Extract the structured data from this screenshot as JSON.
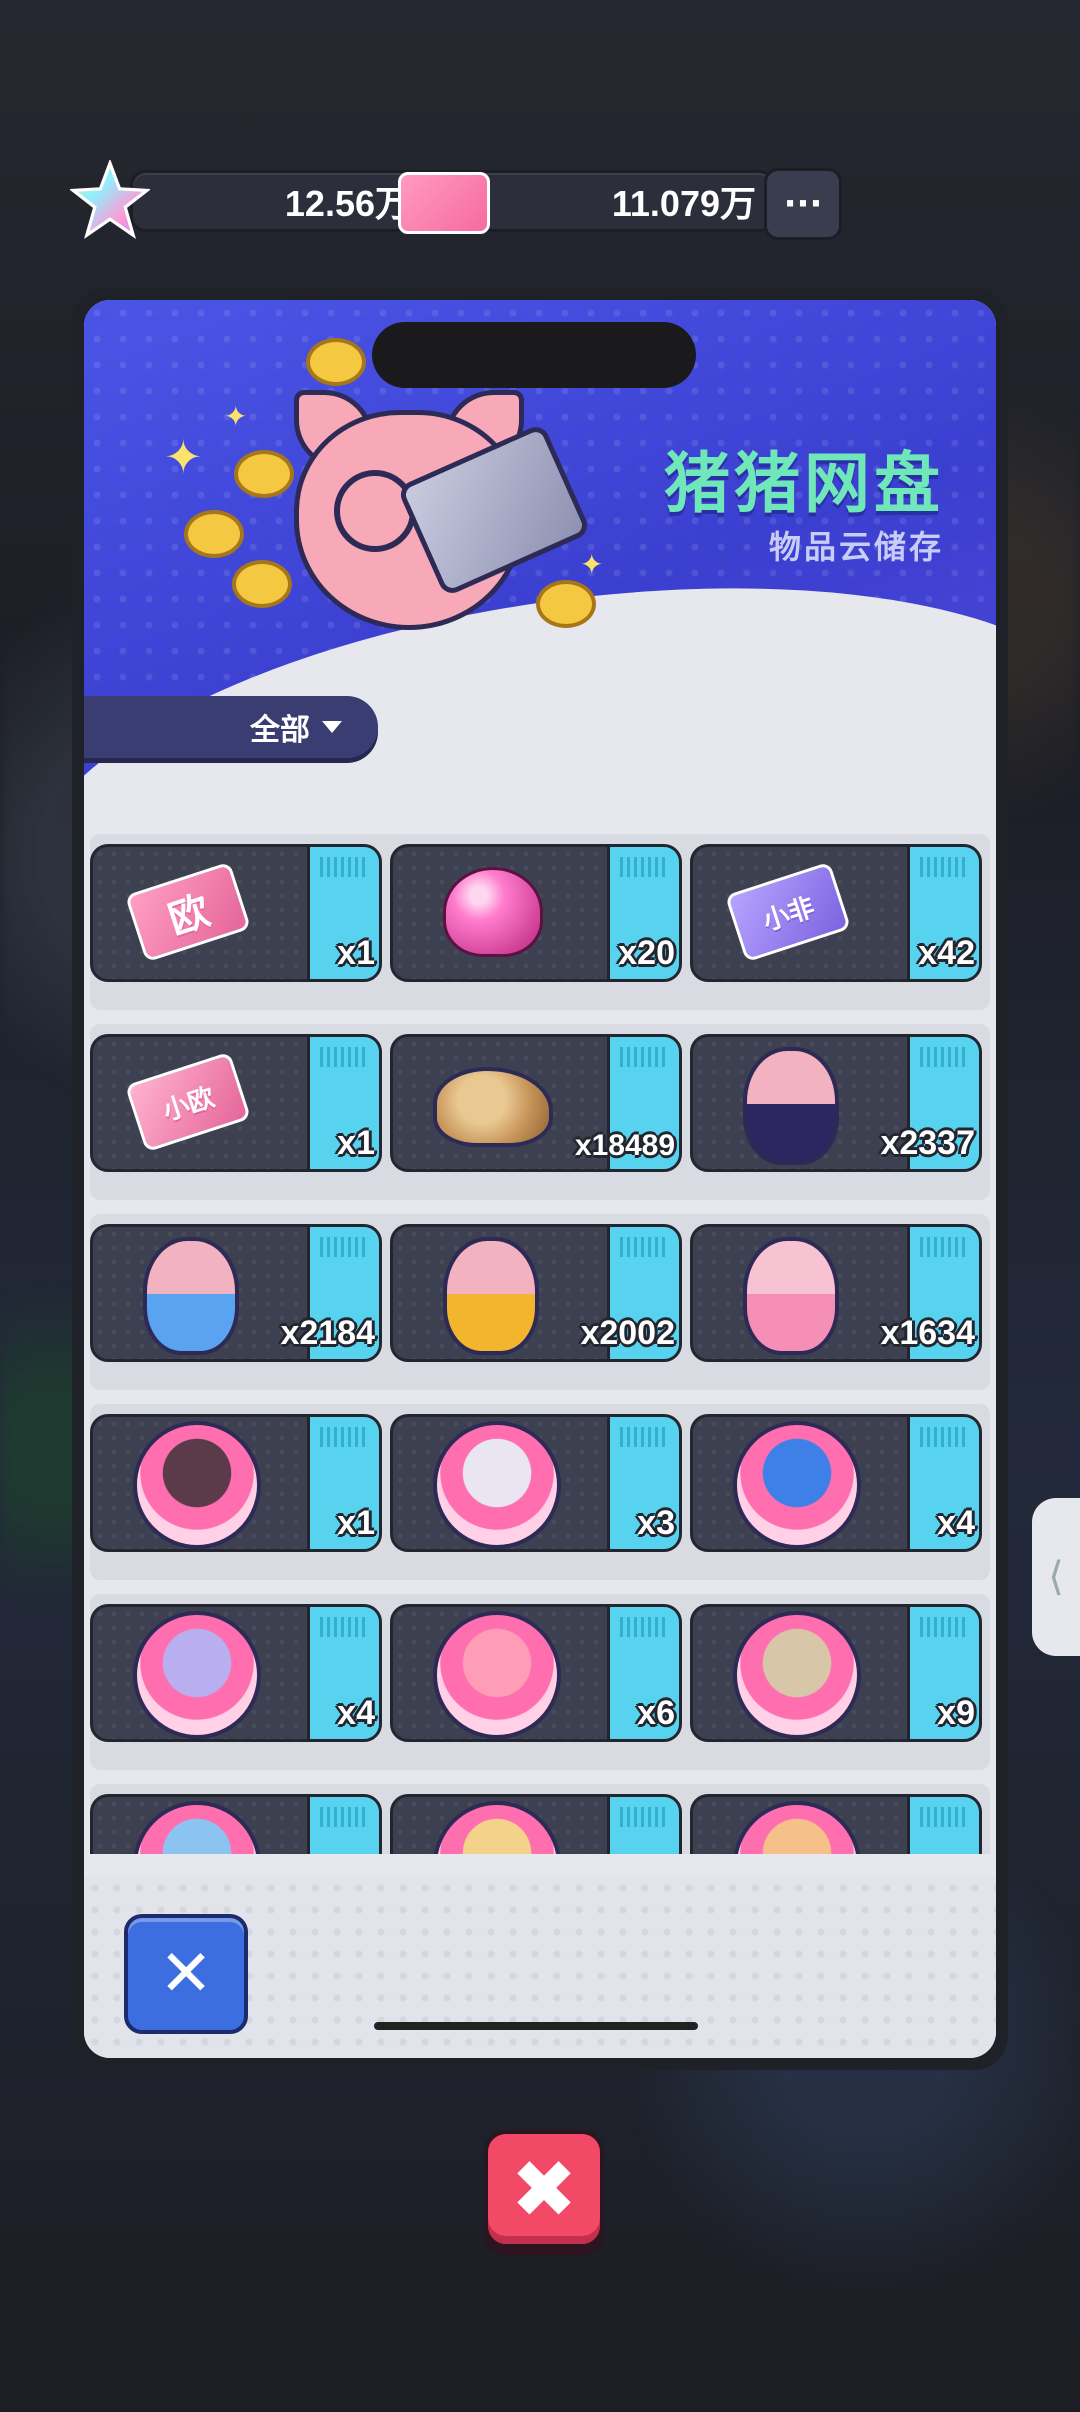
{
  "currency": {
    "stars": "12.56万",
    "tickets": "11.079万",
    "more_label": "···"
  },
  "banner": {
    "title": "猪猪网盘",
    "subtitle": "物品云储存"
  },
  "filter": {
    "label": "全部"
  },
  "items": [
    {
      "kind": "ticket-pink",
      "text": "欧",
      "count": "x1"
    },
    {
      "kind": "gem",
      "text": "",
      "count": "x20"
    },
    {
      "kind": "ticket-purple",
      "text": "小非",
      "count": "x42"
    },
    {
      "kind": "ticket-pink-small",
      "text": "小欧",
      "count": "x1"
    },
    {
      "kind": "bread",
      "text": "",
      "count": "x18489"
    },
    {
      "kind": "pig-dark",
      "text": "",
      "count": "x2337"
    },
    {
      "kind": "pig-blue",
      "text": "",
      "count": "x2184"
    },
    {
      "kind": "pig-yellow",
      "text": "",
      "count": "x2002"
    },
    {
      "kind": "pig-pink",
      "text": "",
      "count": "x1634"
    },
    {
      "kind": "avatar-1",
      "text": "",
      "count": "x1"
    },
    {
      "kind": "avatar-2",
      "text": "",
      "count": "x3"
    },
    {
      "kind": "avatar-3",
      "text": "",
      "count": "x4"
    },
    {
      "kind": "avatar-4",
      "text": "",
      "count": "x4"
    },
    {
      "kind": "avatar-5",
      "text": "",
      "count": "x6"
    },
    {
      "kind": "avatar-6",
      "text": "",
      "count": "x9"
    },
    {
      "kind": "avatar-7",
      "text": "",
      "count": ""
    },
    {
      "kind": "avatar-8",
      "text": "",
      "count": ""
    },
    {
      "kind": "avatar-9",
      "text": "",
      "count": ""
    }
  ],
  "buttons": {
    "close_panel": "✕",
    "close_popup": "✖",
    "side_tab": "⟨"
  },
  "colors": {
    "accent_blue": "#3c6ee0",
    "close_red": "#f24966",
    "tag_cyan": "#57d3ef",
    "title_green": "#6fe7b9"
  }
}
